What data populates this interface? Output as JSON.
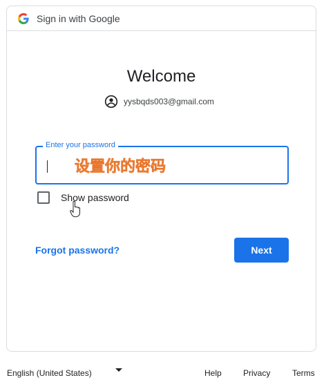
{
  "header": {
    "title": "Sign in with Google",
    "logo_icon": "google-g-icon",
    "logo_colors": {
      "blue": "#4285F4",
      "red": "#EA4335",
      "yellow": "#FBBC05",
      "green": "#34A853"
    }
  },
  "welcome": {
    "title": "Welcome",
    "account": {
      "icon": "account-circle-icon",
      "email": "yysbqds003@gmail.com"
    }
  },
  "password_field": {
    "label": "Enter your password",
    "value": ""
  },
  "overlay": {
    "text": "设置你的密码",
    "color": "#f7a24e"
  },
  "show_password": {
    "label": "Show password",
    "checked": false
  },
  "actions": {
    "forgot_password": "Forgot password?",
    "next": "Next"
  },
  "footer": {
    "language": "English (United States)",
    "links": [
      "Help",
      "Privacy",
      "Terms"
    ]
  },
  "colors": {
    "accent": "#1a73e8",
    "text": "#202124",
    "border": "#dadce0"
  }
}
